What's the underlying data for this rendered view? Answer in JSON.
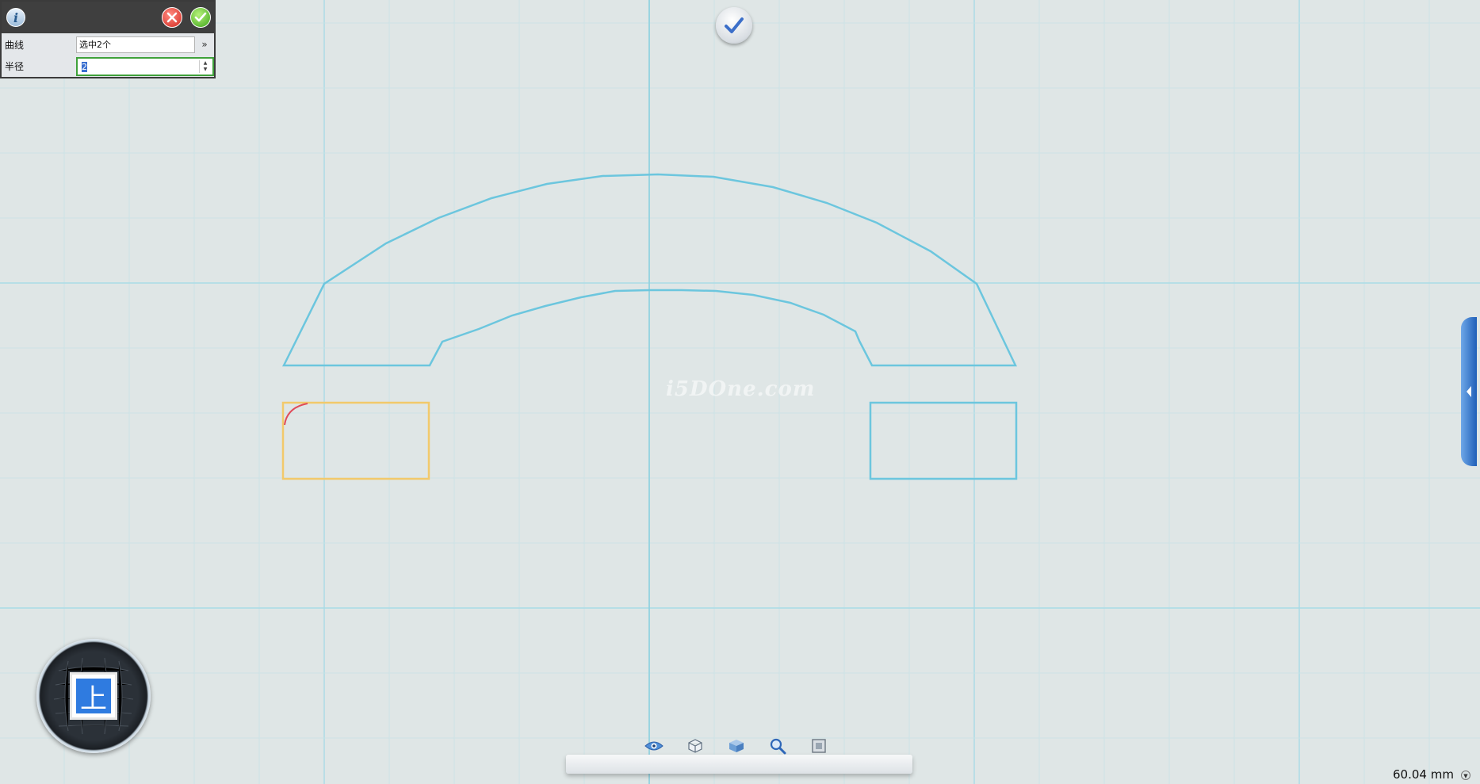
{
  "panel": {
    "curve_label": "曲线",
    "curve_value": "选中2个",
    "radius_label": "半径",
    "radius_value": "2"
  },
  "view_cube": {
    "face_label": "上"
  },
  "scale": {
    "readout": "60.04 mm"
  },
  "watermark": "i5DOne.com",
  "colors": {
    "canvas_bg": "#dfe6e6",
    "grid_line": "#a9dbe5",
    "sketch_line": "#6cc6de",
    "selected_line": "#f2c96b",
    "fillet_preview": "#e04b5a",
    "accent_blue": "#2f7be0"
  },
  "icons": {
    "info": "info-icon",
    "cancel": "close-icon",
    "confirm": "check-icon",
    "done": "check-icon",
    "side_tab": "chevron-left-icon",
    "toolbar": [
      "eye-icon",
      "cube-wire-icon",
      "cube-solid-icon",
      "magnifier-icon",
      "fit-view-icon"
    ]
  }
}
